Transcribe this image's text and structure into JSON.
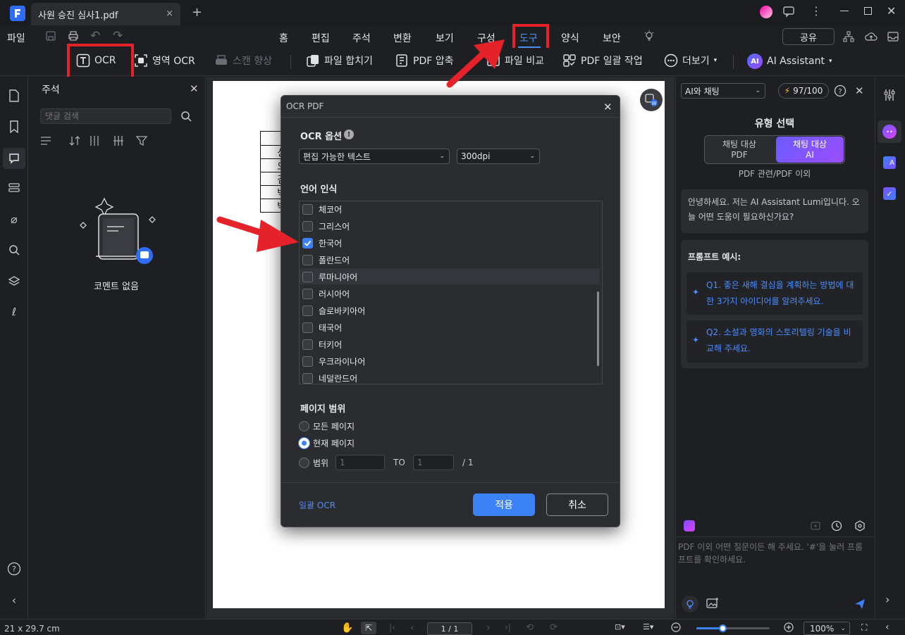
{
  "titlebar": {
    "tab_title": "사원 승진 심사1.pdf",
    "close": "×",
    "add": "+"
  },
  "menubar": {
    "file": "파일",
    "items": [
      "홈",
      "편집",
      "주석",
      "변환",
      "보기",
      "구성",
      "도구",
      "양식",
      "보안"
    ],
    "share": "공유"
  },
  "toolbar": {
    "ocr": "OCR",
    "area_ocr": "영역 OCR",
    "scan_enhance": "스캔 향상",
    "merge": "파일 합치기",
    "compress": "PDF 압축",
    "compare": "파일 비교",
    "batch": "PDF 일괄 작업",
    "more": "더보기",
    "ai_assistant": "AI Assistant",
    "ai_badge": "AI"
  },
  "comments_panel": {
    "title": "주석",
    "search_placeholder": "댓글 검색",
    "empty_text": "코멘트 없음"
  },
  "document": {
    "table_cells": [
      "성",
      "오",
      "김",
      "박",
      "박"
    ]
  },
  "ocr_dialog": {
    "title": "OCR PDF",
    "options_label": "OCR 옵션",
    "mode_value": "편집 가능한 텍스트",
    "dpi_value": "300dpi",
    "language_label": "언어 인식",
    "languages": [
      {
        "name": "체코어",
        "checked": false
      },
      {
        "name": "그리스어",
        "checked": false
      },
      {
        "name": "한국어",
        "checked": true
      },
      {
        "name": "폴란드어",
        "checked": false
      },
      {
        "name": "루마니아어",
        "checked": false
      },
      {
        "name": "러시아어",
        "checked": false
      },
      {
        "name": "슬로바키아어",
        "checked": false
      },
      {
        "name": "태국어",
        "checked": false
      },
      {
        "name": "터키어",
        "checked": false
      },
      {
        "name": "우크라이나어",
        "checked": false
      },
      {
        "name": "네덜란드어",
        "checked": false
      }
    ],
    "page_range_label": "페이지 범위",
    "all_pages": "모든 페이지",
    "current_page": "현재 페이지",
    "range": "범위",
    "range_from": "1",
    "range_to_label": "TO",
    "range_to": "1",
    "range_total": "/ 1",
    "batch_ocr": "일괄 OCR",
    "apply": "적용",
    "cancel": "취소"
  },
  "ai_panel": {
    "mode_select": "AI와 채팅",
    "credits": "97/100",
    "type_title": "유형 선택",
    "opt_pdf": "채팅 대상\nPDF",
    "opt_ai": "채팅 대상\nAI",
    "caption": "PDF 관련/PDF 이외",
    "greeting": "안녕하세요. 저는 AI Assistant Lumi입니다. 오늘 어떤 도움이 필요하신가요?",
    "prompt_title": "프롬프트 예시:",
    "prompts": [
      "Q1. 좋은 새해 결심을 계획하는 방법에 대한 3가지 아이디어를 알려주세요.",
      "Q2. 소설과 영화의 스토리텔링 기술을 비교해 주세요."
    ],
    "input_placeholder": "PDF 이외 어떤 질문이든 해 주세요. '#'을 눌러 프롬프트를 확인하세요."
  },
  "statusbar": {
    "page_size": "21 x 29.7 cm",
    "page_num": "1 / 1",
    "zoom": "100%",
    "zoom_fraction": 0.36
  },
  "colors": {
    "accent": "#3b82f6",
    "annotation_red": "#e5222a",
    "ai_purple": "#7c4dff"
  }
}
